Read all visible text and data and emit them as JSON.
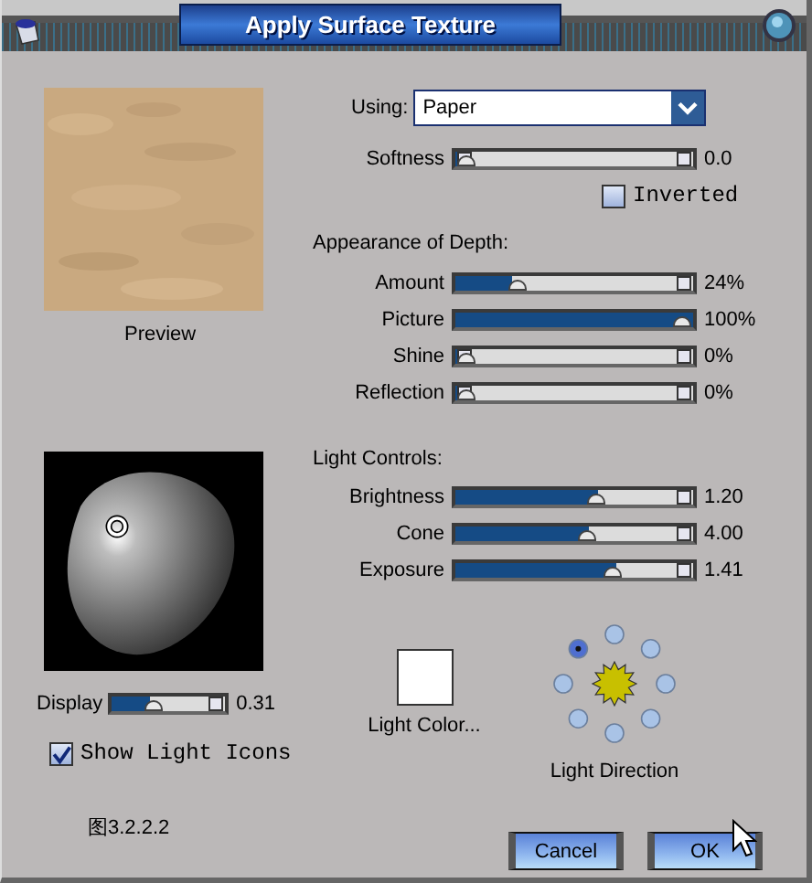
{
  "window": {
    "title": "Apply Surface Texture"
  },
  "preview": {
    "label": "Preview"
  },
  "display": {
    "label": "Display",
    "level": 0.33,
    "reading": "0.31"
  },
  "show_light_icons": {
    "label": "Show Light Icons",
    "checked": true
  },
  "caption": "图3.2.2.2",
  "using": {
    "label": "Using:",
    "value": "Paper"
  },
  "softness": {
    "label": "Softness",
    "level": 0,
    "reading": "0.0"
  },
  "inverted": {
    "label": "Inverted",
    "checked": false
  },
  "depth": {
    "heading": "Appearance of Depth:",
    "sliders": [
      {
        "label": "Amount",
        "level": 0.24,
        "reading": "24%"
      },
      {
        "label": "Picture",
        "level": 1,
        "reading": "100%"
      },
      {
        "label": "Shine",
        "level": 0,
        "reading": "0%"
      },
      {
        "label": "Reflection",
        "level": 0,
        "reading": "0%"
      }
    ]
  },
  "light": {
    "heading": "Light Controls:",
    "sliders": [
      {
        "label": "Brightness",
        "level": 0.6,
        "reading": "1.20"
      },
      {
        "label": "Cone",
        "level": 0.56,
        "reading": "4.00"
      },
      {
        "label": "Exposure",
        "level": 0.68,
        "reading": "1.41"
      }
    ]
  },
  "light_color": {
    "label": "Light Color..."
  },
  "light_direction": {
    "label": "Light Direction",
    "positions": [
      {
        "selected": false
      },
      {
        "selected": false
      },
      {
        "selected": false
      },
      {
        "selected": false
      },
      {
        "selected": false
      },
      {
        "selected": false
      },
      {
        "selected": false
      },
      {
        "selected": true
      }
    ]
  },
  "buttons": [
    {
      "label": "Cancel"
    },
    {
      "label": "OK"
    }
  ]
}
